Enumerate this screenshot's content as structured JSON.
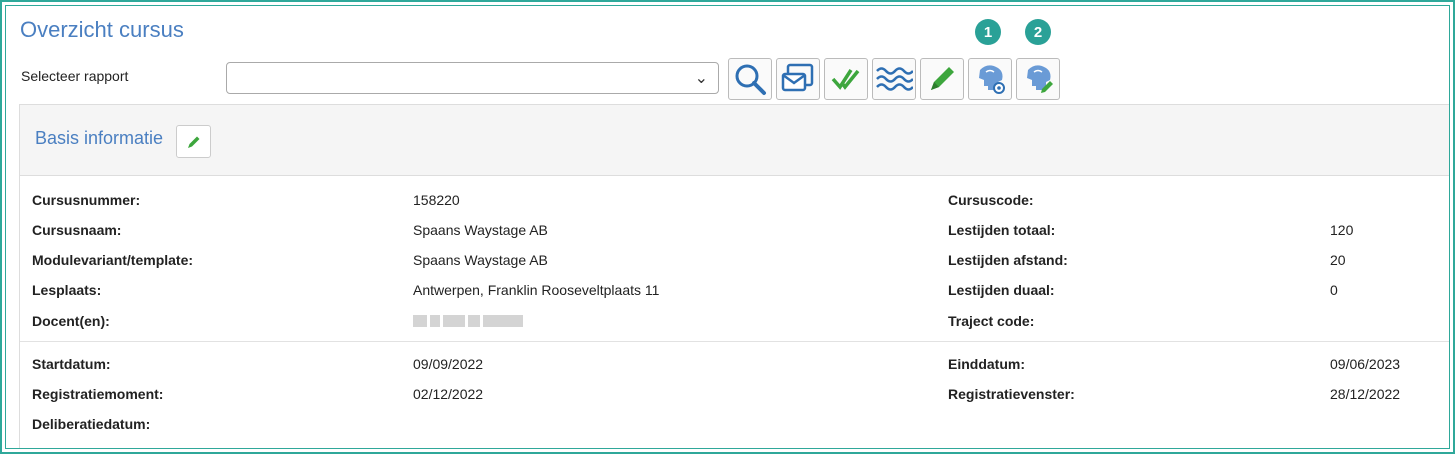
{
  "header": {
    "title": "Overzicht cursus"
  },
  "badges": [
    "1",
    "2"
  ],
  "report": {
    "label": "Selecteer rapport",
    "selected": ""
  },
  "toolbar": [
    {
      "name": "search-icon"
    },
    {
      "name": "mail-print-icon"
    },
    {
      "name": "double-check-icon"
    },
    {
      "name": "waves-icon"
    },
    {
      "name": "pencil-icon"
    },
    {
      "name": "brain-gear-icon"
    },
    {
      "name": "brain-pencil-icon"
    }
  ],
  "panel": {
    "title": "Basis informatie"
  },
  "fields_left": [
    {
      "label": "Cursusnummer:",
      "value": "158220"
    },
    {
      "label": "Cursusnaam:",
      "value": "Spaans Waystage AB"
    },
    {
      "label": "Modulevariant/template:",
      "value": "Spaans Waystage AB"
    },
    {
      "label": "Lesplaats:",
      "value": "Antwerpen, Franklin Rooseveltplaats 11"
    },
    {
      "label": "Docent(en):",
      "value": ""
    }
  ],
  "fields_right": [
    {
      "label": "Cursuscode:",
      "value": ""
    },
    {
      "label": "Lestijden totaal:",
      "value": "120"
    },
    {
      "label": "Lestijden afstand:",
      "value": "20"
    },
    {
      "label": "Lestijden duaal:",
      "value": "0"
    },
    {
      "label": "Traject code:",
      "value": ""
    }
  ],
  "dates_left": [
    {
      "label": "Startdatum:",
      "value": "09/09/2022"
    },
    {
      "label": "Registratiemoment:",
      "value": "02/12/2022"
    },
    {
      "label": "Deliberatiedatum:",
      "value": ""
    }
  ],
  "dates_right": [
    {
      "label": "Einddatum:",
      "value": "09/06/2023"
    },
    {
      "label": "Registratievenster:",
      "value": "28/12/2022"
    }
  ],
  "colors": {
    "accent": "#4a7fc1",
    "badge": "#2aa197",
    "border": "#2fa89a"
  }
}
